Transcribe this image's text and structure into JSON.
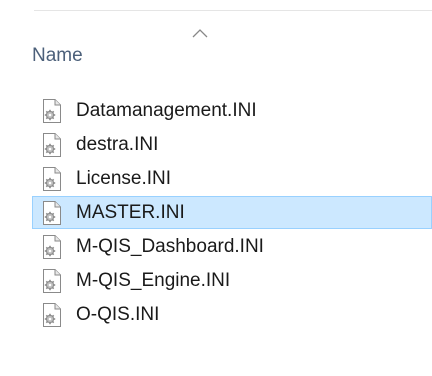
{
  "header": {
    "name_column_label": "Name",
    "sort_icon": "chevron-up-icon"
  },
  "files": [
    {
      "name": "Datamanagement.INI",
      "icon": "ini-config-file-icon",
      "selected": false
    },
    {
      "name": "destra.INI",
      "icon": "ini-config-file-icon",
      "selected": false
    },
    {
      "name": "License.INI",
      "icon": "ini-config-file-icon",
      "selected": false
    },
    {
      "name": "MASTER.INI",
      "icon": "ini-config-file-icon",
      "selected": true
    },
    {
      "name": "M-QIS_Dashboard.INI",
      "icon": "ini-config-file-icon",
      "selected": false
    },
    {
      "name": "M-QIS_Engine.INI",
      "icon": "ini-config-file-icon",
      "selected": false
    },
    {
      "name": "O-QIS.INI",
      "icon": "ini-config-file-icon",
      "selected": false
    }
  ],
  "colors": {
    "selection_background": "#cce8ff",
    "selection_border": "#99d1ff",
    "header_text": "#4c607a"
  }
}
